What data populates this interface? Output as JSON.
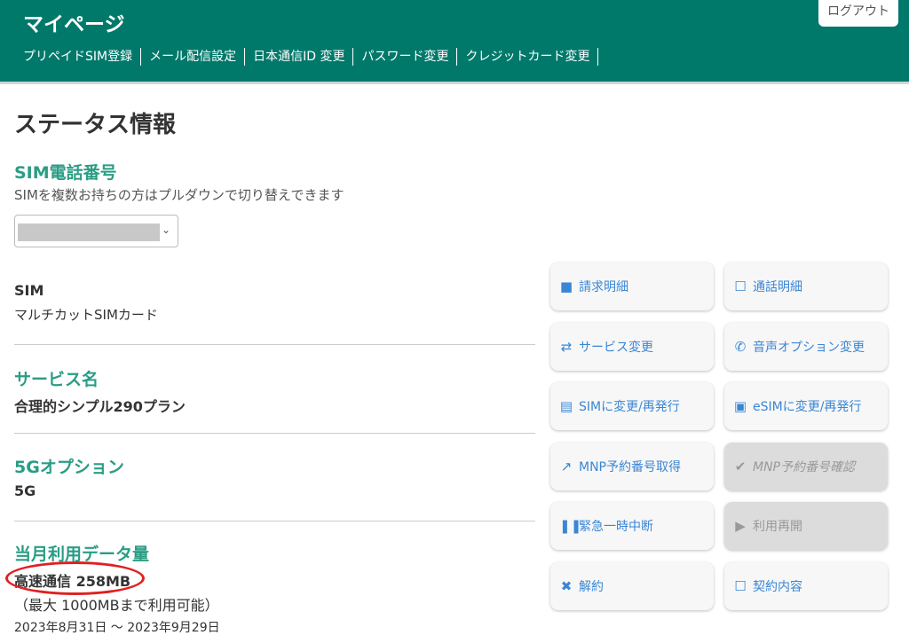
{
  "header": {
    "title": "マイページ",
    "logout": "ログアウト",
    "nav": [
      "プリペイドSIM登録",
      "メール配信設定",
      "日本通信ID 変更",
      "パスワード変更",
      "クレジットカード変更"
    ]
  },
  "page_title": "ステータス情報",
  "sim_number": {
    "heading": "SIM電話番号",
    "note": "SIMを複数お持ちの方はプルダウンで切り替えできます",
    "selected": ""
  },
  "sim": {
    "label": "SIM",
    "value": "マルチカットSIMカード"
  },
  "service": {
    "label": "サービス名",
    "value": "合理的シンプル290プラン"
  },
  "option5g": {
    "label": "5Gオプション",
    "value": "5G"
  },
  "data_usage": {
    "label": "当月利用データ量",
    "value": "高速通信 258MB",
    "limit": "（最大 1000MBまで利用可能）",
    "period": "2023年8月31日 ～ 2023年9月29日"
  },
  "buttons": [
    {
      "label": "請求明細",
      "icon": "■",
      "enabled": true
    },
    {
      "label": "通話明細",
      "icon": "☐",
      "enabled": true
    },
    {
      "label": "サービス変更",
      "icon": "⇄",
      "enabled": true
    },
    {
      "label": "音声オプション変更",
      "icon": "✆",
      "enabled": true
    },
    {
      "label": "SIMに変更/再発行",
      "icon": "▤",
      "enabled": true
    },
    {
      "label": "eSIMに変更/再発行",
      "icon": "▣",
      "enabled": true
    },
    {
      "label": "MNP予約番号取得",
      "icon": "↗",
      "enabled": true
    },
    {
      "label": "MNP予約番号確認",
      "icon": "✔",
      "enabled": false
    },
    {
      "label": "緊急一時中断",
      "icon": "❚❚",
      "enabled": true
    },
    {
      "label": "利用再開",
      "icon": "▶",
      "enabled": false
    },
    {
      "label": "解約",
      "icon": "✖",
      "enabled": true
    },
    {
      "label": "契約内容",
      "icon": "☐",
      "enabled": true
    }
  ],
  "colors": {
    "header": "#00796b",
    "accent": "#2a9d84",
    "link": "#3a86d4",
    "highlight": "#e02020"
  }
}
